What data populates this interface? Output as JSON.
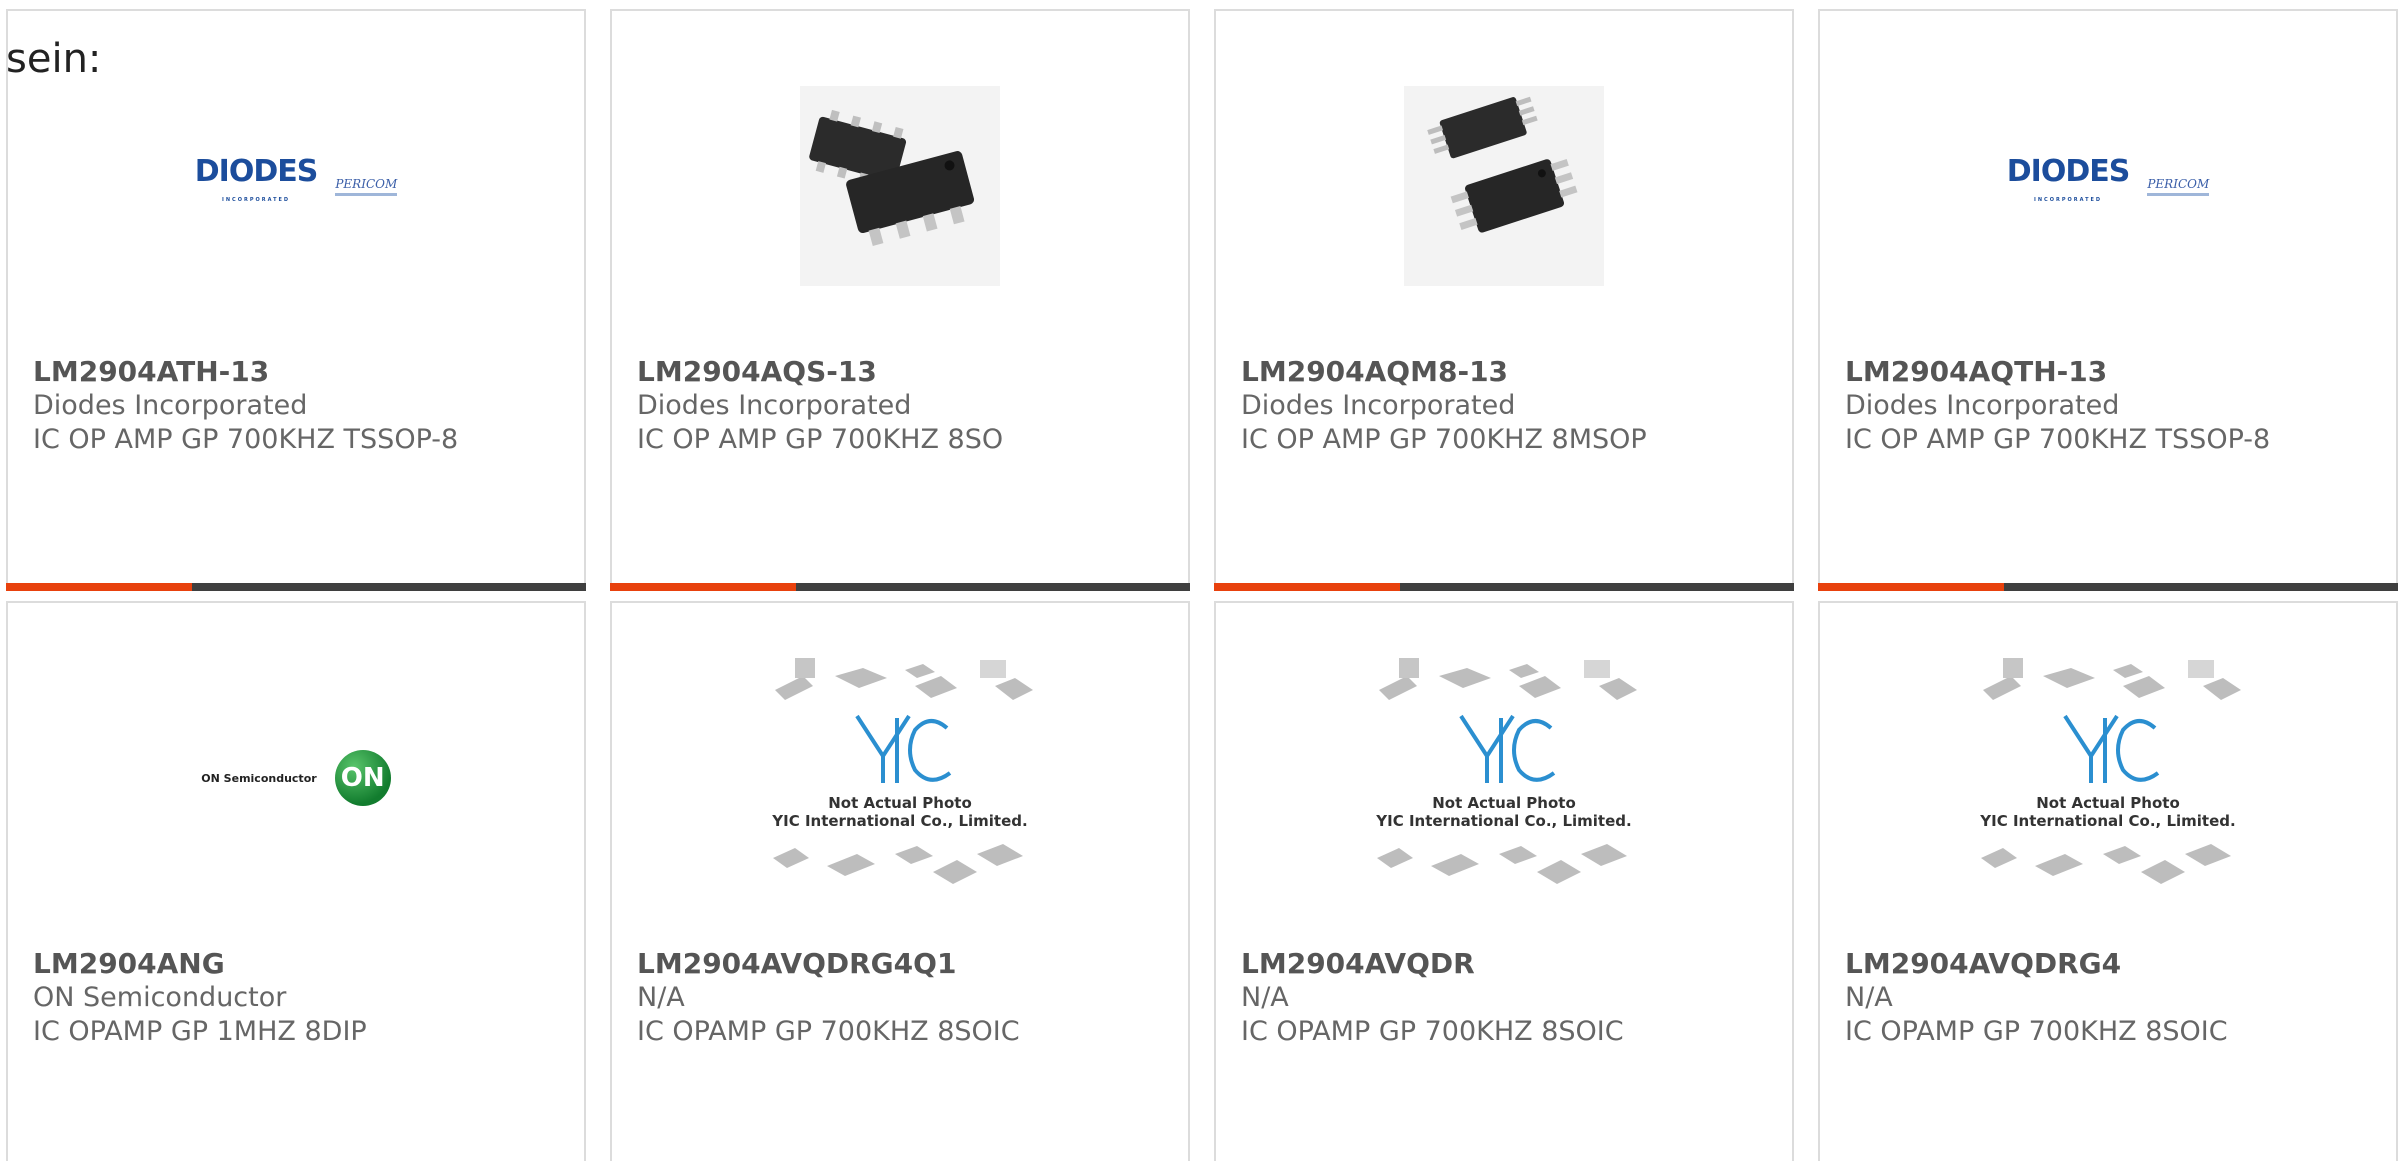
{
  "intro_text": "sein:",
  "accent_color": "#e8410d",
  "progress_fraction": 0.32,
  "cards": [
    {
      "part_number": "LM2904ATH-13",
      "manufacturer": "Diodes Incorporated",
      "description": "IC OP AMP GP 700KHZ TSSOP-8",
      "image_icon": "diodes-pericom-logo",
      "logo_text": "DIODES",
      "logo_subtext": "INCORPORATED",
      "logo2_text": "PERICOM"
    },
    {
      "part_number": "LM2904AQS-13",
      "manufacturer": "Diodes Incorporated",
      "description": "IC OP AMP GP 700KHZ 8SO",
      "image_icon": "soic-8-chip-photo"
    },
    {
      "part_number": "LM2904AQM8-13",
      "manufacturer": "Diodes Incorporated",
      "description": "IC OP AMP GP 700KHZ 8MSOP",
      "image_icon": "msop-8-chip-photo"
    },
    {
      "part_number": "LM2904AQTH-13",
      "manufacturer": "Diodes Incorporated",
      "description": "IC OP AMP GP 700KHZ TSSOP-8",
      "image_icon": "diodes-pericom-logo",
      "logo_text": "DIODES",
      "logo_subtext": "INCORPORATED",
      "logo2_text": "PERICOM"
    },
    {
      "part_number": "LM2904ANG",
      "manufacturer": "ON Semiconductor",
      "description": "IC OPAMP GP 1MHZ 8DIP",
      "image_icon": "on-semiconductor-logo",
      "logo_text": "ON Semiconductor",
      "logo2_text": "ON"
    },
    {
      "part_number": "LM2904AVQDRG4Q1",
      "manufacturer": "N/A",
      "description": "IC OPAMP GP 700KHZ 8SOIC",
      "image_icon": "yic-placeholder-image",
      "photo_note": "Not Actual Photo",
      "photo_company": "YIC International Co., Limited."
    },
    {
      "part_number": "LM2904AVQDR",
      "manufacturer": "N/A",
      "description": "IC OPAMP GP 700KHZ 8SOIC",
      "image_icon": "yic-placeholder-image",
      "photo_note": "Not Actual Photo",
      "photo_company": "YIC International Co., Limited."
    },
    {
      "part_number": "LM2904AVQDRG4",
      "manufacturer": "N/A",
      "description": "IC OPAMP GP 700KHZ 8SOIC",
      "image_icon": "yic-placeholder-image",
      "photo_note": "Not Actual Photo",
      "photo_company": "YIC International Co., Limited."
    }
  ]
}
